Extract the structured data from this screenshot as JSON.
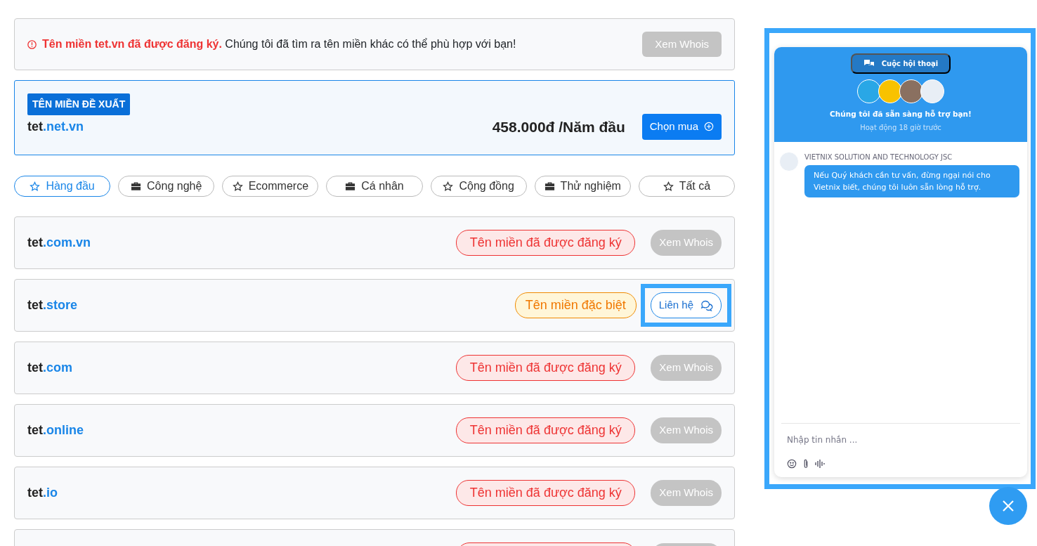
{
  "alert": {
    "strong": "Tên miền tet.vn đã được đăng ký.",
    "text": "Chúng tôi đã tìm ra tên miền khác có thể phù hợp với bạn!",
    "button": "Xem Whois"
  },
  "suggested": {
    "badge": "TÊN MIỀN ĐỀ XUẤT",
    "name": "tet",
    "tld": ".net.vn",
    "price": "458.000đ /Năm đầu",
    "button": "Chọn mua"
  },
  "filters": [
    {
      "label": "Hàng đầu",
      "kind": "featured",
      "selected": true
    },
    {
      "label": "Công nghệ",
      "kind": "category",
      "selected": false
    },
    {
      "label": "Ecommerce",
      "kind": "featured",
      "selected": false
    },
    {
      "label": "Cá nhân",
      "kind": "category",
      "selected": false
    },
    {
      "label": "Cộng đồng",
      "kind": "featured",
      "selected": false
    },
    {
      "label": "Thử nghiệm",
      "kind": "category",
      "selected": false
    },
    {
      "label": "Tất cả",
      "kind": "featured",
      "selected": false
    }
  ],
  "domains": [
    {
      "name": "tet",
      "tld": ".com.vn",
      "kind": "taken",
      "status": "Tên miền đã được đăng ký",
      "button": "Xem Whois"
    },
    {
      "name": "tet",
      "tld": ".store",
      "kind": "special",
      "status": "Tên miền đặc biệt",
      "button": "Liên hệ",
      "highlighted": true
    },
    {
      "name": "tet",
      "tld": ".com",
      "kind": "taken",
      "status": "Tên miền đã được đăng ký",
      "button": "Xem Whois"
    },
    {
      "name": "tet",
      "tld": ".online",
      "kind": "taken",
      "status": "Tên miền đã được đăng ký",
      "button": "Xem Whois"
    },
    {
      "name": "tet",
      "tld": ".io",
      "kind": "taken",
      "status": "Tên miền đã được đăng ký",
      "button": "Xem Whois"
    },
    {
      "kind": "taken"
    }
  ],
  "chat": {
    "highlighted": true,
    "tab": "Cuộc hội thoại",
    "headline": "Chúng tôi đã sẵn sàng hỗ trợ bạn!",
    "activity": "Hoạt động 18 giờ trước",
    "sender": "VIETNIX SOLUTION AND TECHNOLOGY JSC",
    "message": "Nếu Quý khách cần tư vấn, đừng ngại nói cho Vietnix biết, chúng tôi luôn sẵn lòng hỗ trợ.",
    "input": {
      "placeholder": "Nhập tin nhắn ..."
    }
  }
}
